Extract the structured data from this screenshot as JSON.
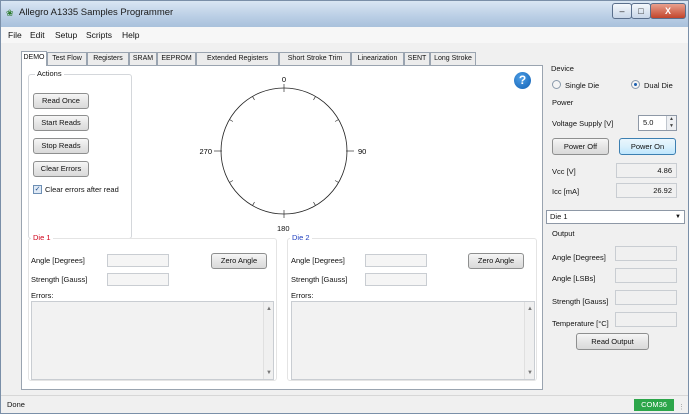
{
  "window": {
    "title": "Allegro A1335 Samples Programmer",
    "min": "–",
    "max": "□",
    "close": "X"
  },
  "menu": [
    "File",
    "Edit",
    "Setup",
    "Scripts",
    "Help"
  ],
  "tabs": [
    "DEMO",
    "Test Flow",
    "Registers",
    "SRAM",
    "EEPROM",
    "Extended Registers",
    "Short Stroke Trim",
    "Linearization",
    "SENT",
    "Long Stroke"
  ],
  "actions": {
    "group_label": "Actions",
    "read_once": "Read Once",
    "start_reads": "Start Reads",
    "stop_reads": "Stop Reads",
    "clear_errors": "Clear Errors",
    "clear_after_read_label": "Clear errors after read",
    "clear_after_read_checked": "✓"
  },
  "dial": {
    "top": "0",
    "right": "90",
    "bottom": "180",
    "left": "270"
  },
  "help": "?",
  "die1": {
    "title": "Die 1",
    "angle_label": "Angle [Degrees]",
    "strength_label": "Strength [Gauss]",
    "errors_label": "Errors:",
    "zero_button": "Zero Angle"
  },
  "die2": {
    "title": "Die 2",
    "angle_label": "Angle [Degrees]",
    "strength_label": "Strength [Gauss]",
    "errors_label": "Errors:",
    "zero_button": "Zero Angle"
  },
  "device": {
    "group_label": "Device",
    "single_die": "Single Die",
    "dual_die": "Dual Die",
    "power_label": "Power",
    "voltage_label": "Voltage Supply [V]",
    "voltage_value": "5.0",
    "power_off": "Power Off",
    "power_on": "Power On",
    "vcc_label": "Vcc [V]",
    "vcc_value": "4.86",
    "icc_label": "Icc [mA]",
    "icc_value": "26.92"
  },
  "output": {
    "die_select": "Die 1",
    "group_label": "Output",
    "angle_degrees": "Angle [Degrees]",
    "angle_lsbs": "Angle [LSBs]",
    "strength": "Strength [Gauss]",
    "temperature": "Temperature [°C]",
    "read_output": "Read Output"
  },
  "status": {
    "text": "Done",
    "port": "COM36"
  },
  "colors": {
    "die1": "#d0021b",
    "die2": "#1f3fbf",
    "port_bg": "#2ca64a"
  }
}
